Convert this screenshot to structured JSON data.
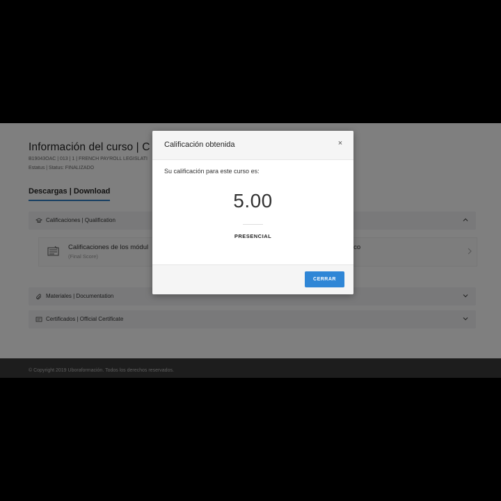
{
  "page": {
    "title": "Información del curso | C",
    "meta_code": "B19043OAC | 013 | 1 | FRENCH PAYROLL LEGISLATI",
    "meta_status": "Estatus | Status: FINALIZADO",
    "tab_active": "Descargas | Download"
  },
  "accordions": [
    {
      "label": "Calificaciones | Qualification",
      "icon": "graduation-icon",
      "state": "expanded"
    },
    {
      "label": "Materiales | Documentation",
      "icon": "paperclip-icon",
      "state": "collapsed"
    },
    {
      "label": "Certificados | Official Certificate",
      "icon": "certificate-icon",
      "state": "collapsed"
    }
  ],
  "grade_item": {
    "title": "Calificaciones de los módul",
    "subtitle": "(Final Score)",
    "right_text": "ico"
  },
  "footer": {
    "copyright": "© Copyright 2019 Uboraformación. Todos los derechos reservados."
  },
  "modal": {
    "title": "Calificación obtenida",
    "close_label": "×",
    "prompt": "Su calificación para este curso es:",
    "score": "5.00",
    "mode": "PRESENCIAL",
    "button_label": "CERRAR"
  },
  "colors": {
    "accent": "#2f86d6",
    "tab_underline": "#2f7cc4",
    "overlay": "rgba(0,0,0,0.5)"
  }
}
